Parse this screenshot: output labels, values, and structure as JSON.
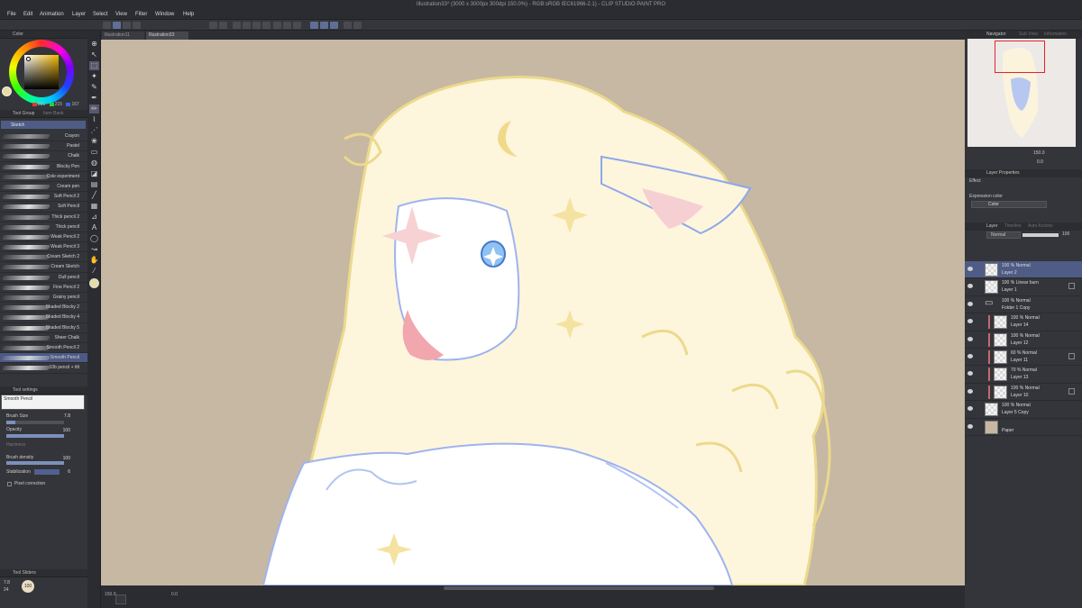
{
  "window": {
    "title": "Illustration33* (3000 x 3000px 300dpi 150.0%) - RGB:sRGB IEC61966-2.1) - CLIP STUDIO PAINT PRO"
  },
  "menu": [
    "File",
    "Edit",
    "Animation",
    "Layer",
    "Select",
    "View",
    "Filter",
    "Window",
    "Help"
  ],
  "doc_tabs": [
    {
      "label": "Illustration11"
    },
    {
      "label": "Illustration33"
    }
  ],
  "color_panel": {
    "header": "Color",
    "rgb": [
      "231",
      "215",
      "167"
    ],
    "main_color": "#e7d7a7"
  },
  "tool_group": {
    "header": "Tool Group",
    "tab2": "Item Bank",
    "subtool": "Sketch"
  },
  "brushes": [
    "Crayon",
    "Pastel",
    "Chalk",
    "Blocky Pen",
    "Cole experiment",
    "Cream pen",
    "Soft Pencil 2",
    "Soft Pencil",
    "Thick pencil 2",
    "Thick pencil",
    "Weak Pencil 2",
    "Weak Pencil 3",
    "Cream Sketch 2",
    "Cream Sketch",
    "Dull pencil",
    "Fine Pencil 2",
    "Grainy pencil",
    "Shaded Blocky 2",
    "Shaded Blocky 4",
    "Shaded Blocky 5",
    "Sheer Chalk",
    "Smooth Pencil 2",
    "Smooth Pencil",
    "10b pencil + tilt"
  ],
  "tool_settings": {
    "header": "Tool settings",
    "preview_label": "Smooth Pencil",
    "brush_size_label": "Brush Size",
    "brush_size": "7.8",
    "brush_size_level": 0.15,
    "opacity_label": "Opacity",
    "opacity": "100",
    "opacity_level": 1.0,
    "hardness_label": "Hardness",
    "density_label": "Brush density",
    "density": "100",
    "density_level": 1.0,
    "stabilization_label": "Stabilization",
    "stabilization": "6",
    "pixel_correction_label": "Pixel correction"
  },
  "tool_sliders": {
    "header": "Tool Sliders",
    "size": "7.8",
    "sub": "24",
    "badge": "100"
  },
  "status": {
    "zoom": "150.0",
    "rotation": "0.0"
  },
  "navigator": {
    "header": "Navigator",
    "tab2": "Sub View",
    "tab3": "Information",
    "zoom": "150.0",
    "rotation": "0.0"
  },
  "layer_properties": {
    "header": "Layer Properties",
    "effect_label": "Effect",
    "expression_label": "Expression color",
    "expression_value": "Color"
  },
  "layer_panel": {
    "header": "Layer",
    "tab2": "Timeline",
    "tab3": "Auto Actions",
    "blend_mode": "Normal",
    "opacity": "100"
  },
  "layers": [
    {
      "mode": "100 % Normal",
      "name": "Layer 2",
      "active": true,
      "clip": false,
      "mask": false,
      "thumb": "check"
    },
    {
      "mode": "100 % Linear burn",
      "name": "Layer 1",
      "active": false,
      "clip": false,
      "mask": true,
      "thumb": "check"
    },
    {
      "mode": "100 % Normal",
      "name": "Folder 1 Copy",
      "active": false,
      "clip": false,
      "mask": false,
      "thumb": "folder"
    },
    {
      "mode": "100 % Normal",
      "name": "Layer 14",
      "active": false,
      "clip": true,
      "mask": false,
      "thumb": "check"
    },
    {
      "mode": "100 % Normal",
      "name": "Layer 12",
      "active": false,
      "clip": true,
      "mask": false,
      "thumb": "check"
    },
    {
      "mode": "60 % Normal",
      "name": "Layer 11",
      "active": false,
      "clip": true,
      "mask": true,
      "thumb": "check"
    },
    {
      "mode": "70 % Normal",
      "name": "Layer 13",
      "active": false,
      "clip": true,
      "mask": false,
      "thumb": "check"
    },
    {
      "mode": "100 % Normal",
      "name": "Layer 10",
      "active": false,
      "clip": true,
      "mask": true,
      "thumb": "check"
    },
    {
      "mode": "100 % Normal",
      "name": "Layer 5 Copy",
      "active": false,
      "clip": false,
      "mask": false,
      "thumb": "check"
    },
    {
      "mode": "",
      "name": "Paper",
      "active": false,
      "clip": false,
      "mask": false,
      "thumb": "paper"
    }
  ],
  "colors": {
    "canvas_bg": "#c7b8a4",
    "accent": "#4e5c86",
    "panel": "#34353a"
  }
}
